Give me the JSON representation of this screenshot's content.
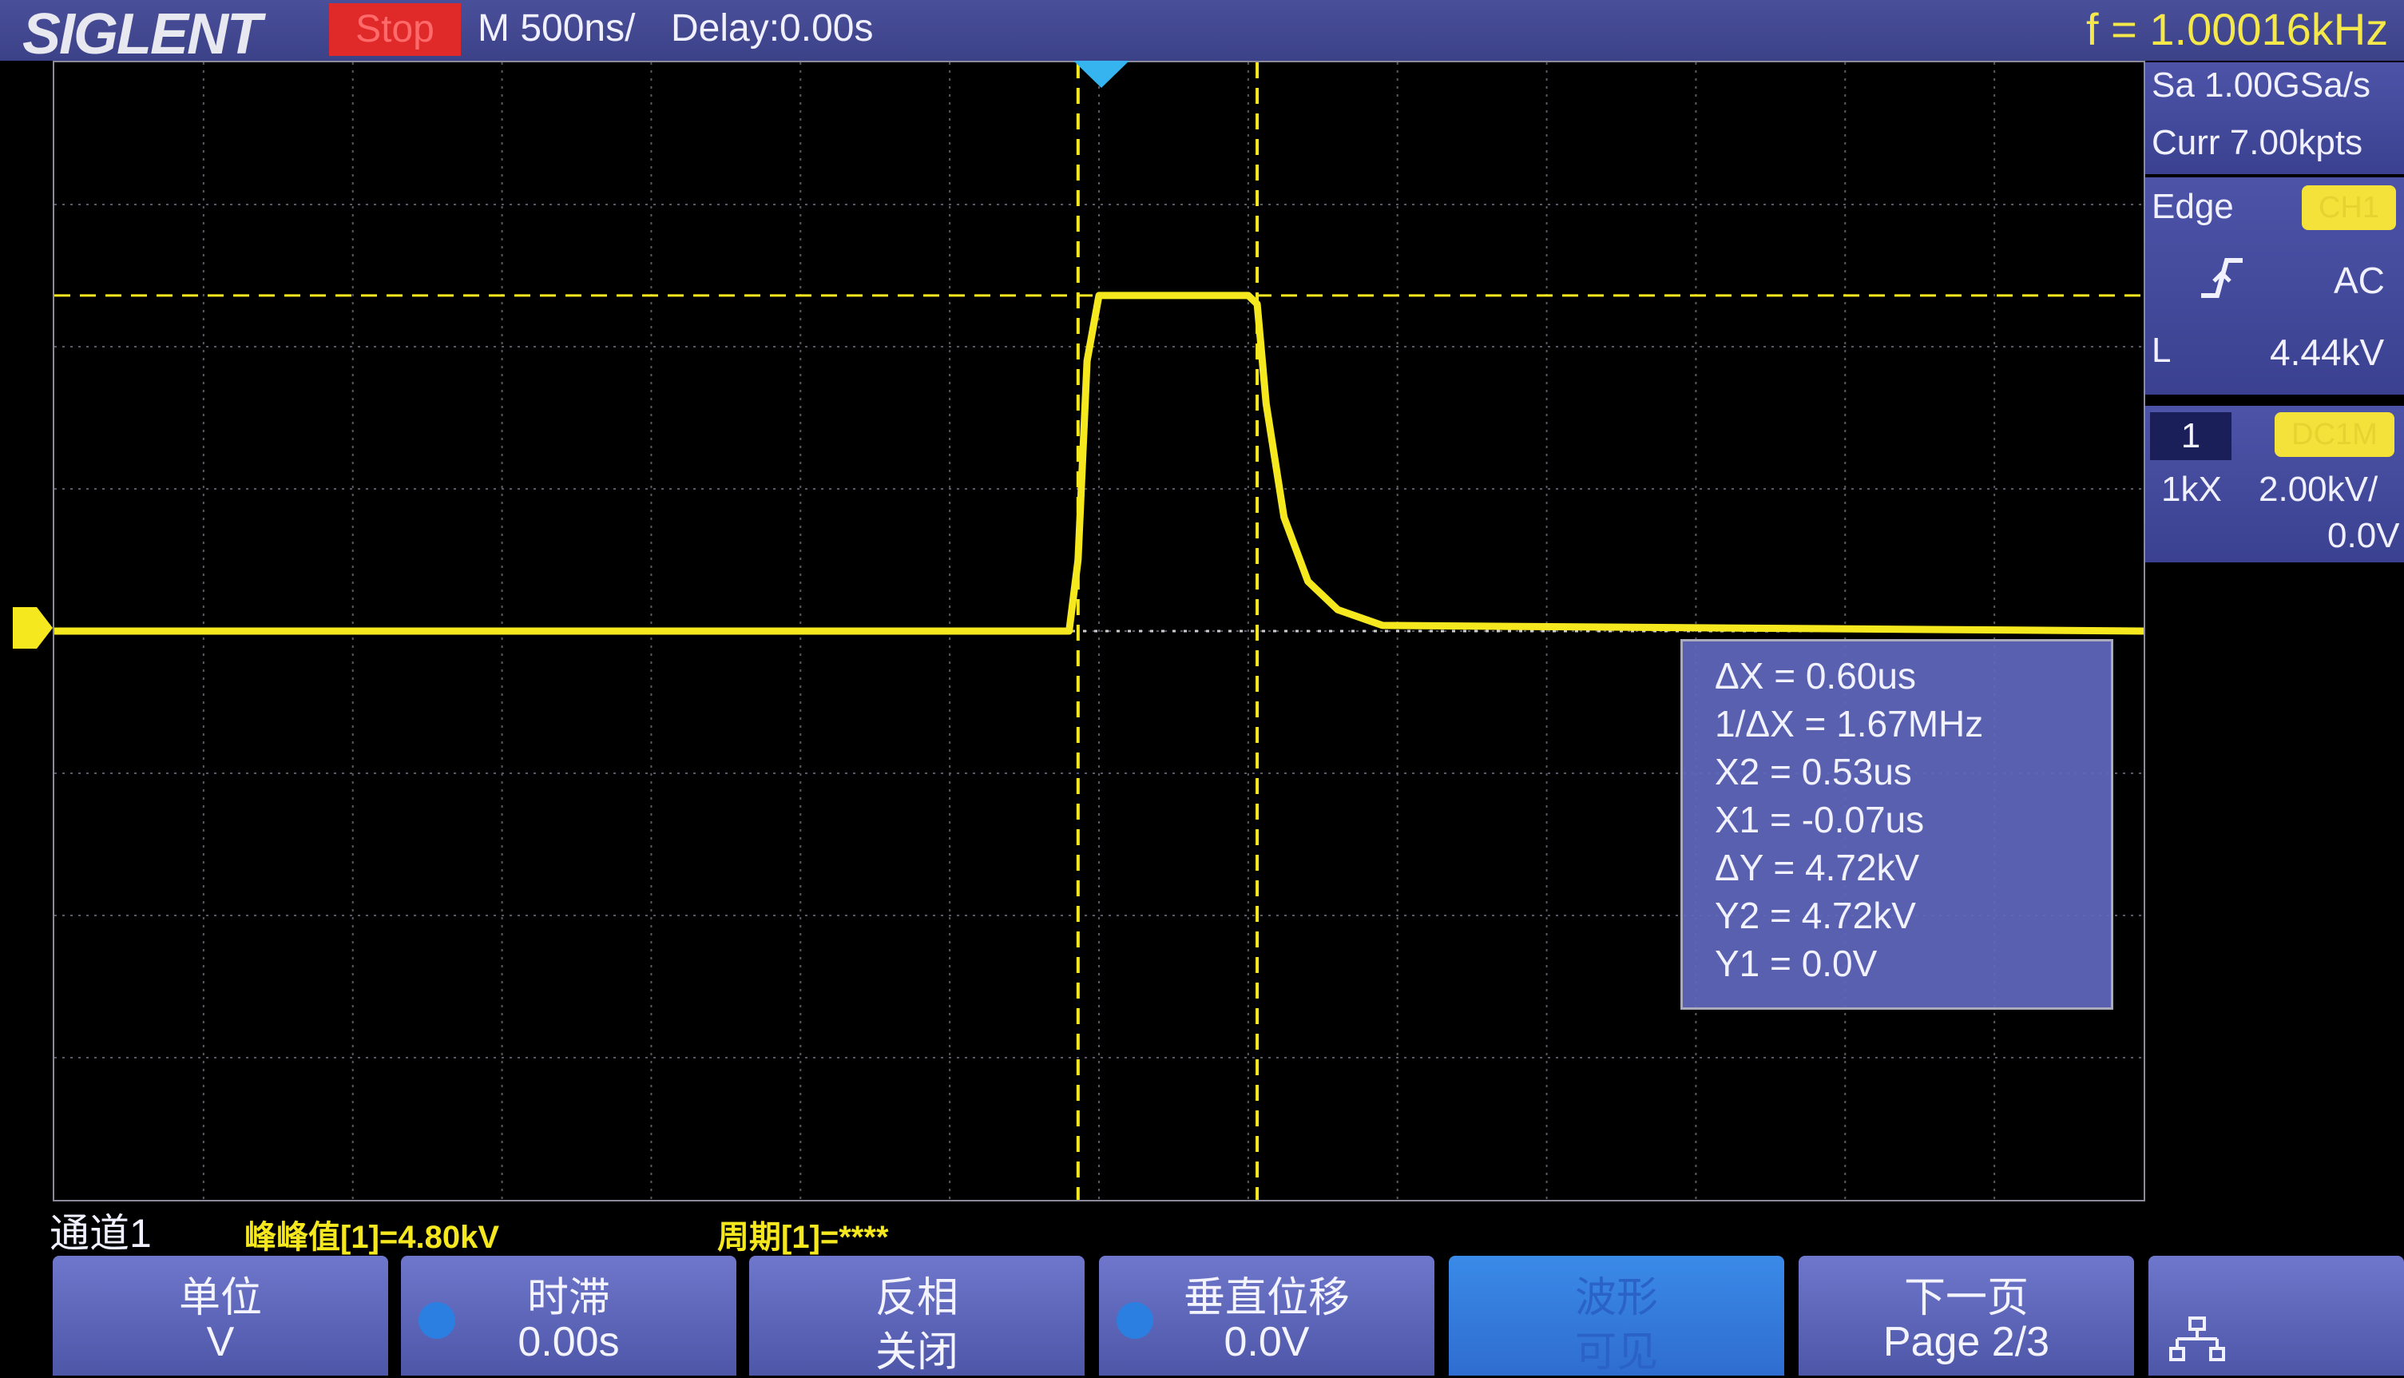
{
  "header": {
    "brand": "SIGLENT",
    "run_state": "Stop",
    "timebase": "M 500ns/",
    "delay": "Delay:0.00s",
    "frequency": "f = 1.00016kHz"
  },
  "acquisition": {
    "sample_rate": "Sa 1.00GSa/s",
    "memory": "Curr 7.00kpts"
  },
  "trigger": {
    "type": "Edge",
    "source": "CH1",
    "coupling": "AC",
    "level_label": "L",
    "level": "4.44kV"
  },
  "channel": {
    "number": "1",
    "coupling_badge": "DC1M",
    "probe": "1kX",
    "scale": "2.00kV/",
    "offset": "0.0V"
  },
  "cursors": {
    "dx": "ΔX = 0.60us",
    "inv_dx": "1/ΔX = 1.67MHz",
    "x2": "X2 = 0.53us",
    "x1": "X1 = -0.07us",
    "dy": "ΔY = 4.72kV",
    "y2": "Y2 = 4.72kV",
    "y1": "Y1 = 0.0V"
  },
  "status": {
    "channel_label": "通道1",
    "measure1": "峰峰值[1]=4.80kV",
    "measure2": "周期[1]=****"
  },
  "menu": [
    {
      "line1": "单位",
      "line2": "V"
    },
    {
      "line1": "时滞",
      "line2": "0.00s"
    },
    {
      "line1": "反相",
      "line2": "关闭"
    },
    {
      "line1": "垂直位移",
      "line2": "0.0V"
    },
    {
      "line1": "波形",
      "line2": "可见"
    },
    {
      "line1": "下一页",
      "line2": "Page 2/3"
    }
  ],
  "colors": {
    "trace": "#f5e81e",
    "accent": "#4a52a6",
    "stop": "#e02a2a"
  },
  "icons": {
    "network": "network-icon"
  },
  "chart_data": {
    "type": "line",
    "title": "",
    "xlabel": "",
    "ylabel": "",
    "x_unit": "us",
    "y_unit": "kV",
    "xlim": [
      -3.5,
      3.5
    ],
    "ylim": [
      -8,
      8
    ],
    "grid": true,
    "series": [
      {
        "x": [
          -3.5,
          -0.1,
          -0.07,
          -0.04,
          0.0,
          0.5,
          0.53,
          0.56,
          0.62,
          0.7,
          0.8,
          0.95,
          3.5
        ],
        "y": [
          0,
          0,
          1.0,
          3.8,
          4.72,
          4.72,
          4.6,
          3.2,
          1.6,
          0.7,
          0.3,
          0.08,
          0
        ]
      }
    ],
    "cursors": {
      "x1": -0.07,
      "x2": 0.53,
      "y1": 0,
      "y2": 4.72
    }
  }
}
